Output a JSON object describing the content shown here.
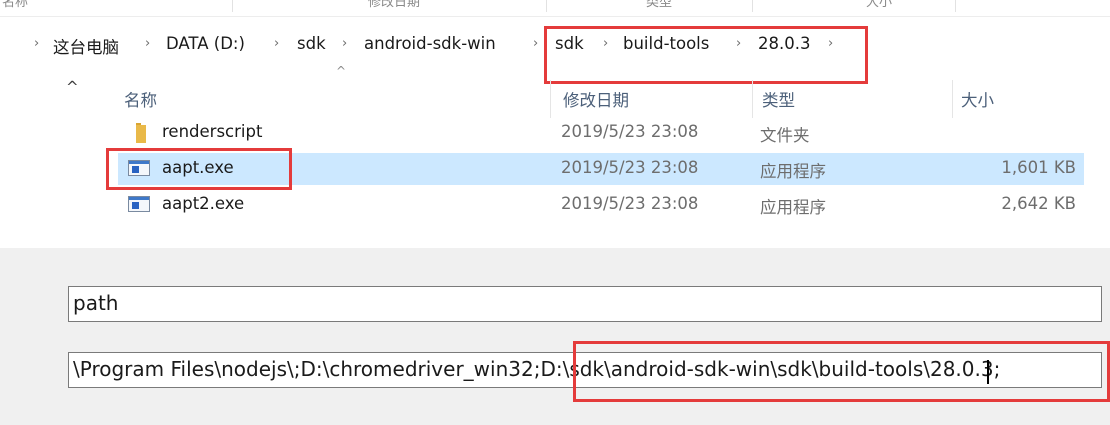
{
  "top_strip": {
    "fragments": [
      "名称",
      "修改日期",
      "类型",
      "大小"
    ]
  },
  "breadcrumb": {
    "items": [
      "这台电脑",
      "DATA (D:)",
      "sdk",
      "android-sdk-win",
      "sdk",
      "build-tools",
      "28.0.3"
    ],
    "separator_icon": "chevron-right-icon"
  },
  "columns": {
    "name": "名称",
    "date": "修改日期",
    "type": "类型",
    "size": "大小"
  },
  "files": [
    {
      "name": "renderscript",
      "date": "2019/5/23 23:08",
      "type": "文件夹",
      "size": "",
      "icon": "folder-icon"
    },
    {
      "name": "aapt.exe",
      "date": "2019/5/23 23:08",
      "type": "应用程序",
      "size": "1,601 KB",
      "icon": "exe-icon",
      "selected": true
    },
    {
      "name": "aapt2.exe",
      "date": "2019/5/23 23:08",
      "type": "应用程序",
      "size": "2,642 KB",
      "icon": "exe-icon"
    }
  ],
  "env": {
    "variable_name": "path",
    "variable_value": "\\Program Files\\nodejs\\;D:\\chromedriver_win32;D:\\sdk\\android-sdk-win\\sdk\\build-tools\\28.0.3;"
  },
  "colors": {
    "highlight": "#e43b3b",
    "selection": "#cce8ff",
    "header_text": "#4c607a"
  }
}
